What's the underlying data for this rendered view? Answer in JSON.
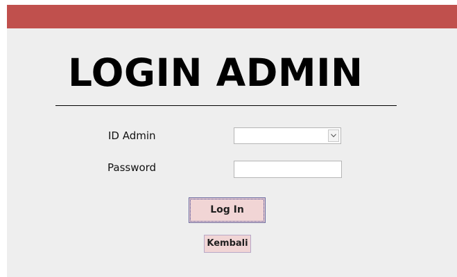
{
  "colors": {
    "titlebar": "#c0504d",
    "background": "#eeeeee",
    "button_fill": "#f1d5d5"
  },
  "form": {
    "title": "LOGIN ADMIN",
    "id_label": "ID Admin",
    "id_value": "",
    "password_label": "Password",
    "password_value": "",
    "dropdown_icon": "chevron-down-icon"
  },
  "buttons": {
    "login_label": "Log In",
    "back_label": "Kembali"
  }
}
